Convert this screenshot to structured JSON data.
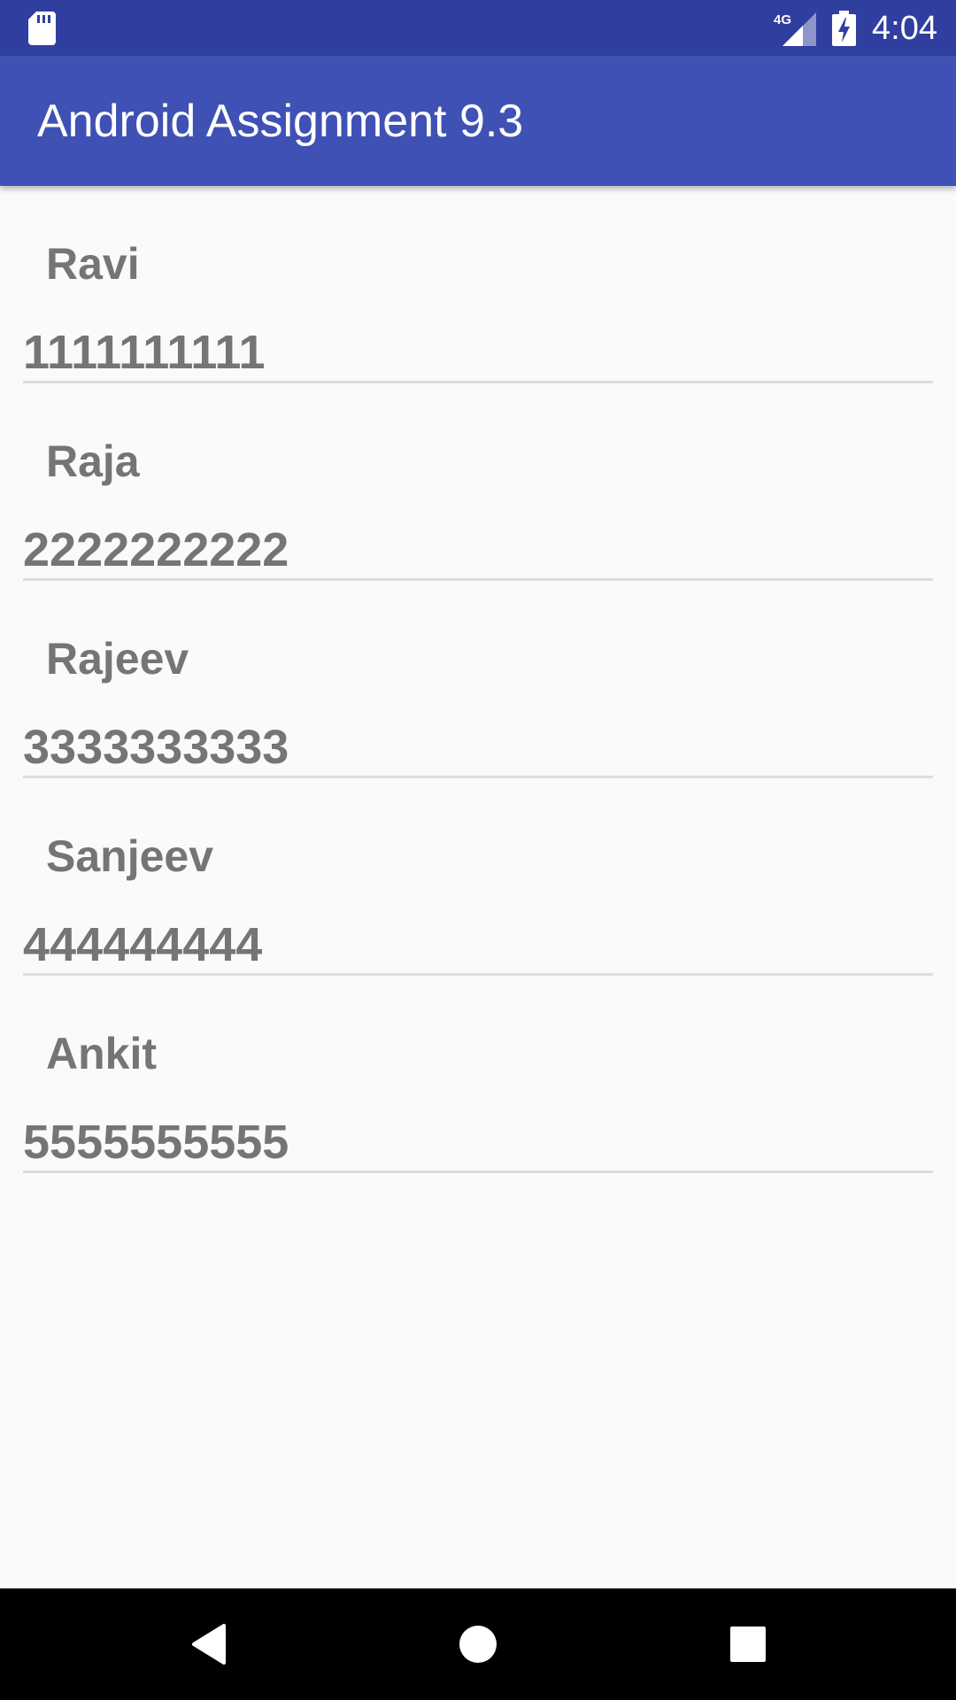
{
  "status_bar": {
    "time": "4:04",
    "network_label": "4G",
    "icons": [
      "sd-card-icon",
      "signal-4g-icon",
      "battery-charging-icon"
    ]
  },
  "app_bar": {
    "title": "Android Assignment 9.3"
  },
  "contacts": [
    {
      "name": "Ravi",
      "phone": "1111111111"
    },
    {
      "name": "Raja",
      "phone": "2222222222"
    },
    {
      "name": "Rajeev",
      "phone": "3333333333"
    },
    {
      "name": "Sanjeev",
      "phone": "444444444"
    },
    {
      "name": "Ankit",
      "phone": "5555555555"
    }
  ],
  "nav_bar": {
    "icons": [
      "back-icon",
      "home-icon",
      "recents-icon"
    ]
  },
  "colors": {
    "status_bar": "#303f9f",
    "app_bar": "#3f51b5",
    "background": "#fafafa",
    "text": "#757575",
    "divider": "#dddddd"
  }
}
